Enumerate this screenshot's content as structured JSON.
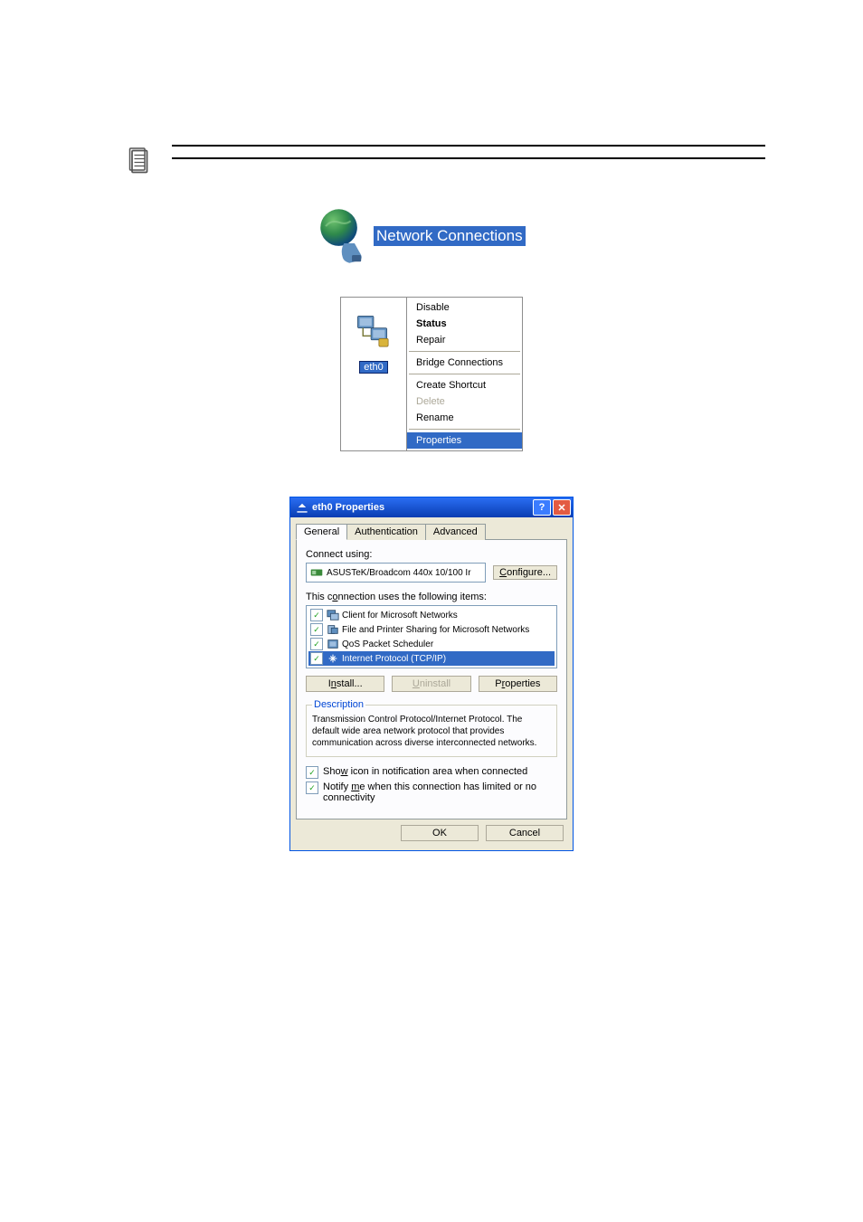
{
  "note_text": "",
  "network_connections_label": "Network Connections",
  "eth_label": "eth0",
  "context_menu": {
    "disable": "Disable",
    "status": "Status",
    "repair": "Repair",
    "bridge": "Bridge Connections",
    "shortcut": "Create Shortcut",
    "delete": "Delete",
    "rename": "Rename",
    "properties": "Properties"
  },
  "dialog": {
    "title": "eth0 Properties",
    "tabs": {
      "general": "General",
      "auth": "Authentication",
      "adv": "Advanced"
    },
    "connect_using_label": "Connect using:",
    "adapter_name": "ASUSTeK/Broadcom 440x 10/100 Ir",
    "configure_btn": "Configure...",
    "items_label": "This connection uses the following items:",
    "items": {
      "client": "Client for Microsoft Networks",
      "fps": "File and Printer Sharing for Microsoft Networks",
      "qos": "QoS Packet Scheduler",
      "tcpip": "Internet Protocol (TCP/IP)"
    },
    "install_btn": "Install...",
    "uninstall_btn": "Uninstall",
    "properties_btn": "Properties",
    "desc_legend": "Description",
    "desc_text": "Transmission Control Protocol/Internet Protocol. The default wide area network protocol that provides communication across diverse interconnected networks.",
    "chk_show_icon": "Show icon in notification area when connected",
    "chk_notify": "Notify me when this connection has limited or no connectivity",
    "ok": "OK",
    "cancel": "Cancel"
  }
}
